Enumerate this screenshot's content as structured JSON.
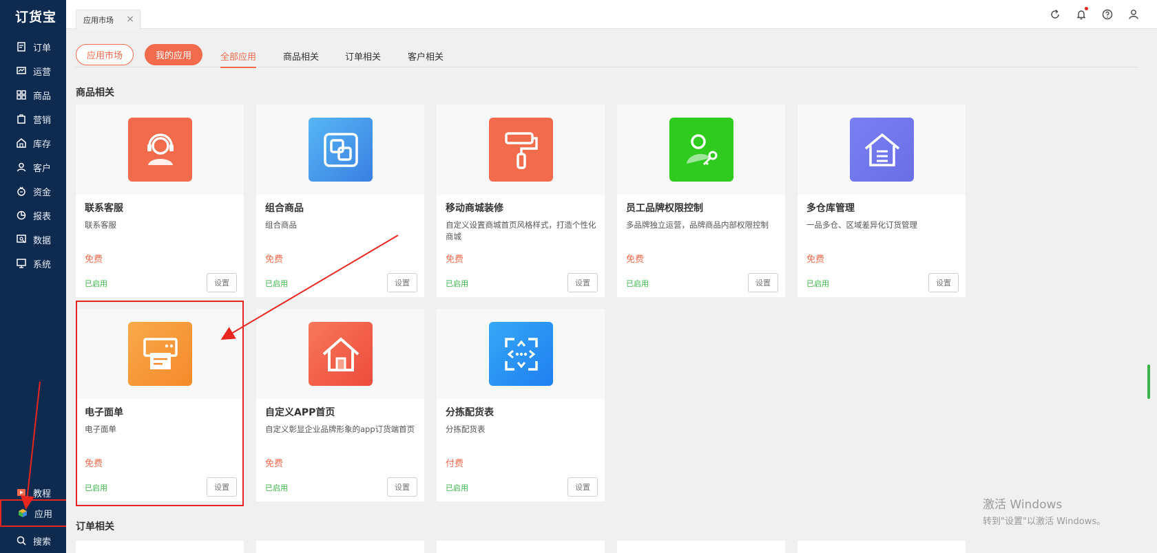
{
  "sidebar": {
    "logo": "订货宝",
    "items": [
      {
        "label": "订单",
        "icon": "order-icon"
      },
      {
        "label": "运营",
        "icon": "operation-icon"
      },
      {
        "label": "商品",
        "icon": "product-icon"
      },
      {
        "label": "营销",
        "icon": "marketing-icon"
      },
      {
        "label": "库存",
        "icon": "inventory-icon"
      },
      {
        "label": "客户",
        "icon": "customer-icon"
      },
      {
        "label": "资金",
        "icon": "money-icon"
      },
      {
        "label": "报表",
        "icon": "report-icon"
      },
      {
        "label": "数据",
        "icon": "data-icon"
      },
      {
        "label": "系统",
        "icon": "system-icon"
      }
    ],
    "bottom_items": [
      {
        "label": "教程",
        "icon": "tutorial-icon"
      },
      {
        "label": "应用",
        "icon": "app-icon"
      },
      {
        "label": "搜索",
        "icon": "search-icon"
      }
    ]
  },
  "topbar": {
    "tab_label": "应用市场",
    "icons": [
      "refresh-icon",
      "bell-icon",
      "help-icon",
      "user-icon"
    ]
  },
  "filter": {
    "pill_market": "应用市场",
    "pill_mine": "我的应用",
    "tabs": [
      "全部应用",
      "商品相关",
      "订单相关",
      "客户相关"
    ]
  },
  "sections": {
    "products_title": "商品相关",
    "orders_title": "订单相关"
  },
  "cards": [
    {
      "name": "联系客服",
      "desc": "联系客服",
      "price": "免费",
      "status": "已启用",
      "button": "设置",
      "icon": "customer-service-icon",
      "color": "#f26b4d"
    },
    {
      "name": "组合商品",
      "desc": "组合商品",
      "price": "免费",
      "status": "已启用",
      "button": "设置",
      "icon": "combo-product-icon",
      "color": "#3a8ee6"
    },
    {
      "name": "移动商城装修",
      "desc": "自定义设置商城首页风格样式，打造个性化商城",
      "price": "免费",
      "status": "已启用",
      "button": "设置",
      "icon": "paint-roller-icon",
      "color": "#f26b4d"
    },
    {
      "name": "员工品牌权限控制",
      "desc": "多品牌独立运营，品牌商品内部权限控制",
      "price": "免费",
      "status": "已启用",
      "button": "设置",
      "icon": "user-key-icon",
      "color": "#2fcc1f"
    },
    {
      "name": "多仓库管理",
      "desc": "一品多仓、区域差异化订货管理",
      "price": "免费",
      "status": "已启用",
      "button": "设置",
      "icon": "warehouse-icon",
      "color": "#6e7ef2"
    },
    {
      "name": "电子面单",
      "desc": "电子面单",
      "price": "免费",
      "status": "已启用",
      "button": "设置",
      "icon": "printer-icon",
      "color": "#f79a3a"
    },
    {
      "name": "自定义APP首页",
      "desc": "自定义彰显企业品牌形象的app订货端首页",
      "price": "免费",
      "status": "已启用",
      "button": "设置",
      "icon": "home-icon",
      "color": "#f26b4d"
    },
    {
      "name": "分拣配货表",
      "desc": "分拣配货表",
      "price": "付费",
      "status": "已启用",
      "button": "设置",
      "icon": "sorting-icon",
      "color": "#2b8ff0"
    }
  ],
  "watermark": {
    "line1": "激活 Windows",
    "line2": "转到\"设置\"以激活 Windows。"
  }
}
